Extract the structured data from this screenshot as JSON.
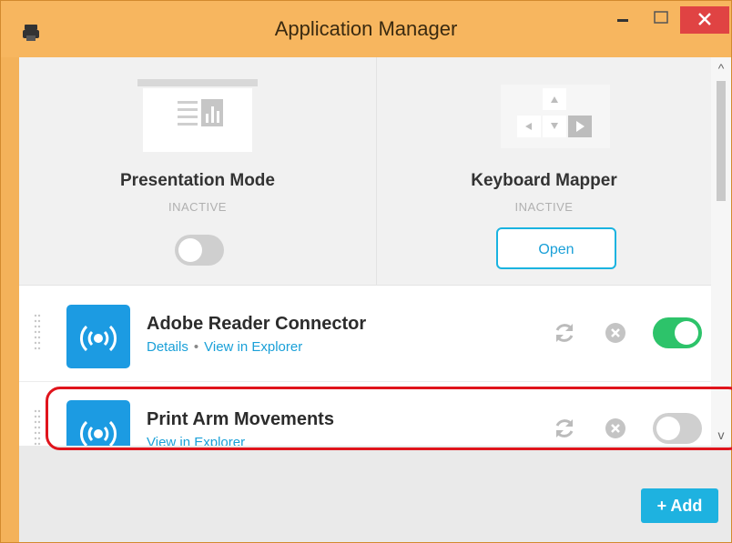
{
  "window": {
    "title": "Application Manager",
    "accent_color": "#f7b65f",
    "icons": {
      "app": "printer-icon",
      "minimize": "minimize-icon",
      "maximize": "maximize-icon",
      "close": "close-icon"
    }
  },
  "tiles": [
    {
      "title": "Presentation Mode",
      "status": "INACTIVE",
      "icon": "presentation-icon",
      "toggle_on": false
    },
    {
      "title": "Keyboard Mapper",
      "status": "INACTIVE",
      "icon": "keyboard-arrows-icon",
      "button_label": "Open"
    }
  ],
  "apps": [
    {
      "name": "Adobe Reader Connector",
      "links": [
        "Details",
        "View in Explorer"
      ],
      "link_separator": "•",
      "enabled": true,
      "icon": "wireless-app-icon",
      "actions": [
        "refresh-icon",
        "remove-icon"
      ]
    },
    {
      "name": "Print Arm Movements",
      "links": [
        "View in Explorer"
      ],
      "enabled": false,
      "icon": "wireless-app-icon",
      "actions": [
        "refresh-icon",
        "remove-icon"
      ]
    }
  ],
  "scrollbar": {
    "up_glyph": "^",
    "down_glyph": "v"
  },
  "footer": {
    "add_label": "+ Add",
    "button_color": "#1eb2e0"
  },
  "highlight": {
    "color": "#e0141c"
  }
}
